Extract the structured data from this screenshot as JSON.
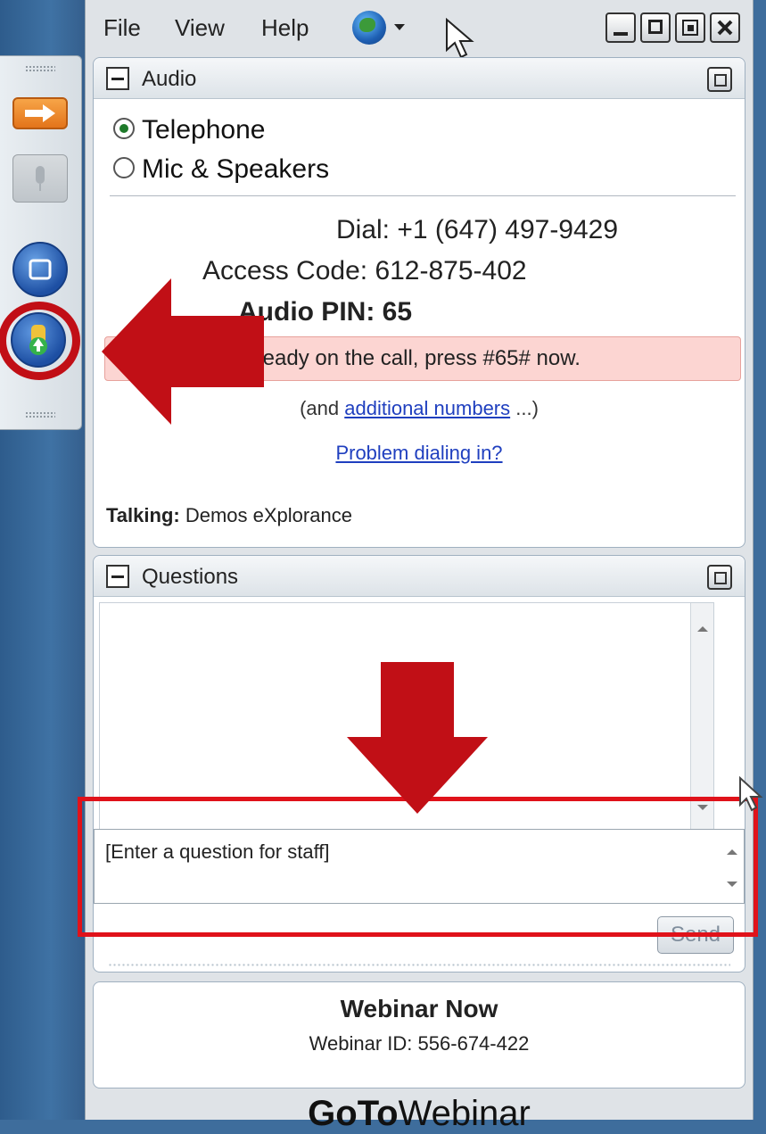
{
  "menu": {
    "file": "File",
    "view": "View",
    "help": "Help"
  },
  "audio": {
    "title": "Audio",
    "option_telephone": "Telephone",
    "option_mic": "Mic & Speakers",
    "selected": "Telephone",
    "dial_label": "Dial:",
    "dial_number": "+1 (647) 497-9429",
    "access_label": "Access Code:",
    "access_code": "612-875-402",
    "pin_label": "Audio PIN:",
    "pin_value": "65",
    "pin_notice": "already on the call, press #65# now.",
    "additional_prefix": "(and ",
    "additional_link": "additional numbers",
    "additional_suffix": " ...)",
    "problem_link": "Problem dialing in?",
    "talking_label": "Talking:",
    "talking_name": "Demos eXplorance"
  },
  "questions": {
    "title": "Questions",
    "input_placeholder": "[Enter a question for staff]",
    "send_label": "Send"
  },
  "footer": {
    "webinar_title": "Webinar Now",
    "webinar_id_label": "Webinar ID:",
    "webinar_id": "556-674-422",
    "brand_part1": "GoTo",
    "brand_part2": "Webinar"
  },
  "colors": {
    "annotation_red": "#c10f16",
    "link_blue": "#1f3fbf",
    "notice_pink": "#fcd5d2"
  },
  "icons": {
    "globe": "globe-icon",
    "hand": "raise-hand-icon",
    "mic": "mic-icon",
    "screen": "screen-icon",
    "arrow": "arrow-right-icon"
  }
}
